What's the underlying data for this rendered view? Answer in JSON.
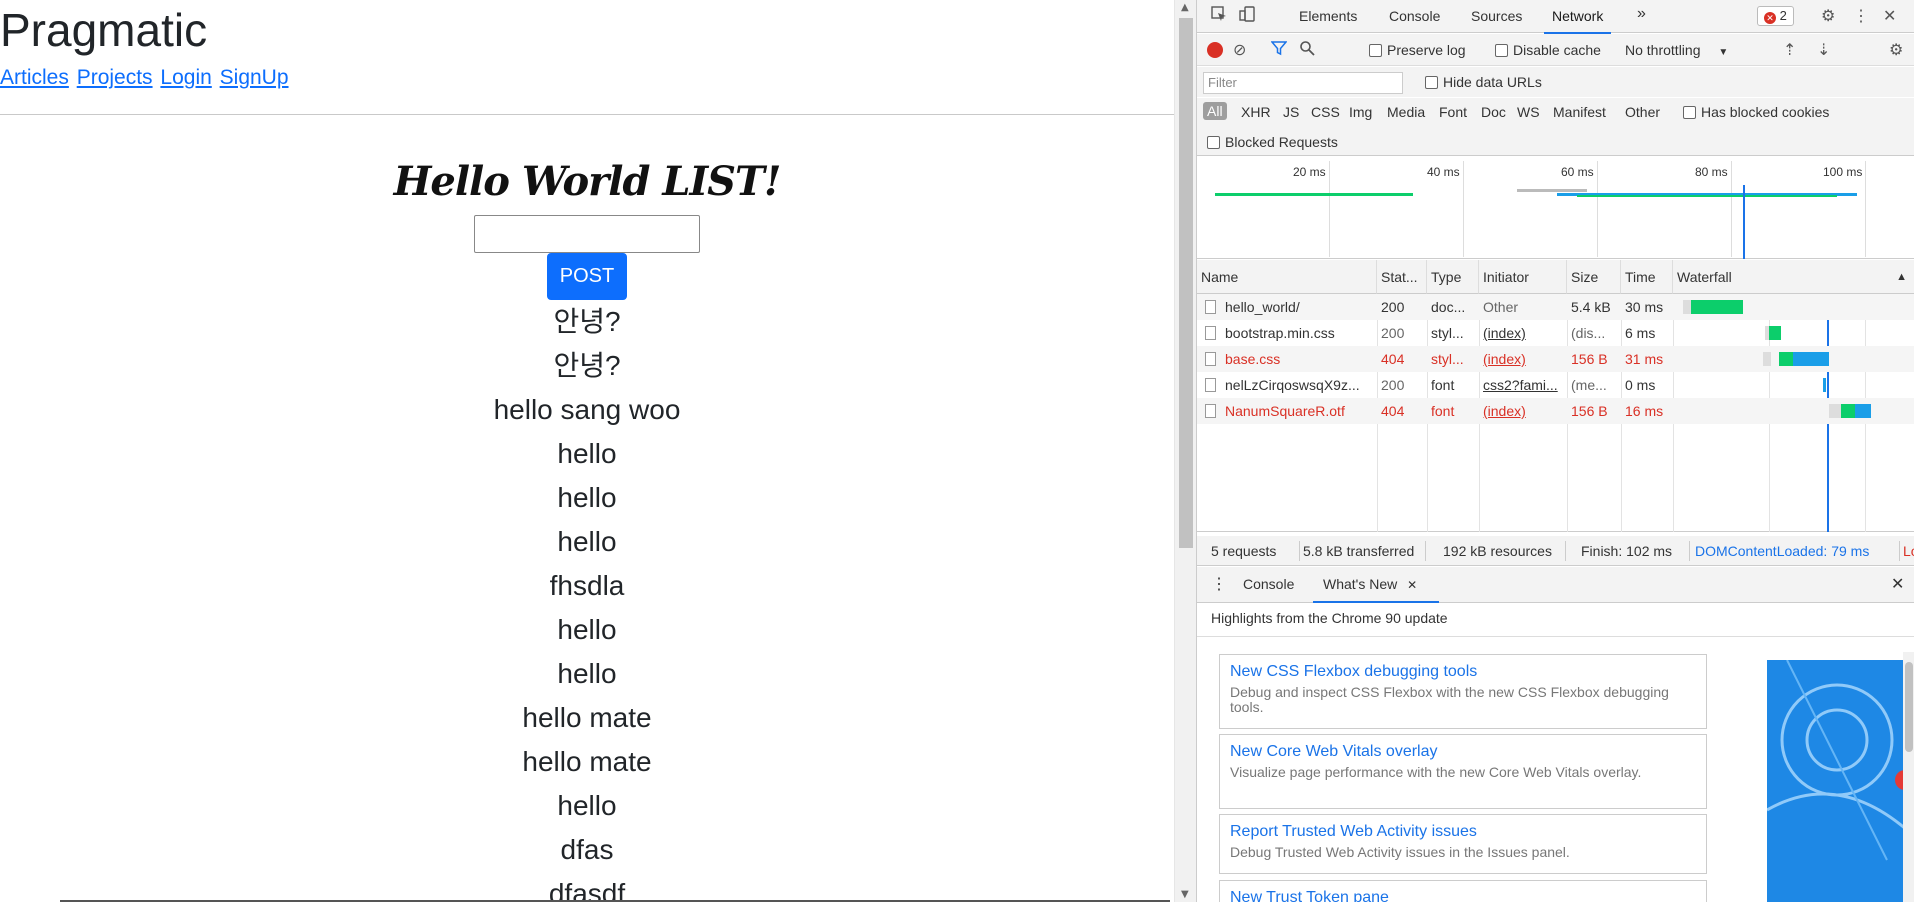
{
  "page": {
    "site_title": "Pragmatic",
    "nav": [
      "Articles",
      "Projects",
      "Login",
      "SignUp"
    ],
    "list_title": "Hello World LIST!",
    "input_value": "",
    "post_button": "POST",
    "items": [
      "안녕?",
      "안녕?",
      "hello sang woo",
      "hello",
      "hello",
      "hello",
      "fhsdla",
      "hello",
      "hello",
      "hello mate",
      "hello mate",
      "hello",
      "dfas",
      "dfasdf"
    ]
  },
  "devtools": {
    "tabs": [
      "Elements",
      "Console",
      "Sources",
      "Network"
    ],
    "active_tab": "Network",
    "more_tabs": "»",
    "error_count": "2",
    "toolbar": {
      "preserve_log": "Preserve log",
      "disable_cache": "Disable cache",
      "throttling": "No throttling"
    },
    "filter": {
      "placeholder": "Filter",
      "hide_data_urls": "Hide data URLs"
    },
    "types": [
      "All",
      "XHR",
      "JS",
      "CSS",
      "Img",
      "Media",
      "Font",
      "Doc",
      "WS",
      "Manifest",
      "Other"
    ],
    "has_blocked_cookies": "Has blocked cookies",
    "blocked_requests": "Blocked Requests",
    "overview_ticks": [
      "20 ms",
      "40 ms",
      "60 ms",
      "80 ms",
      "100 ms"
    ],
    "columns": [
      "Name",
      "Stat...",
      "Type",
      "Initiator",
      "Size",
      "Time",
      "Waterfall"
    ],
    "sort_indicator": "▲",
    "requests": [
      {
        "name": "hello_world/",
        "status": "200",
        "type": "doc...",
        "initiator": "Other",
        "size": "5.4 kB",
        "time": "30 ms"
      },
      {
        "name": "bootstrap.min.css",
        "status": "200",
        "type": "styl...",
        "initiator": "(index)",
        "size": "(dis...",
        "time": "6 ms"
      },
      {
        "name": "base.css",
        "status": "404",
        "type": "styl...",
        "initiator": "(index)",
        "size": "156 B",
        "time": "31 ms"
      },
      {
        "name": "nelLzCirqoswsqX9z...",
        "status": "200",
        "type": "font",
        "initiator": "css2?fami...",
        "size": "(me...",
        "time": "0 ms"
      },
      {
        "name": "NanumSquareR.otf",
        "status": "404",
        "type": "font",
        "initiator": "(index)",
        "size": "156 B",
        "time": "16 ms"
      }
    ],
    "status_bar": {
      "requests": "5 requests",
      "transferred": "5.8 kB transferred",
      "resources": "192 kB resources",
      "finish": "Finish: 102 ms",
      "dom_content_loaded": "DOMContentLoaded: 79 ms",
      "load": "Lo"
    },
    "drawer": {
      "tabs": [
        "Console",
        "What's New"
      ],
      "active_tab": "What's New",
      "highlights": "Highlights from the Chrome 90 update",
      "cards": [
        {
          "title": "New CSS Flexbox debugging tools",
          "desc": "Debug and inspect CSS Flexbox with the new CSS Flexbox debugging tools."
        },
        {
          "title": "New Core Web Vitals overlay",
          "desc": "Visualize page performance with the new Core Web Vitals overlay."
        },
        {
          "title": "Report Trusted Web Activity issues",
          "desc": "Debug Trusted Web Activity issues in the Issues panel."
        },
        {
          "title": "New Trust Token pane",
          "desc": ""
        }
      ]
    },
    "colors": {
      "accent": "#1a73e8",
      "error": "#d93025",
      "waterfall_green": "#0cce6b",
      "waterfall_blue": "#1a9ee8"
    }
  }
}
